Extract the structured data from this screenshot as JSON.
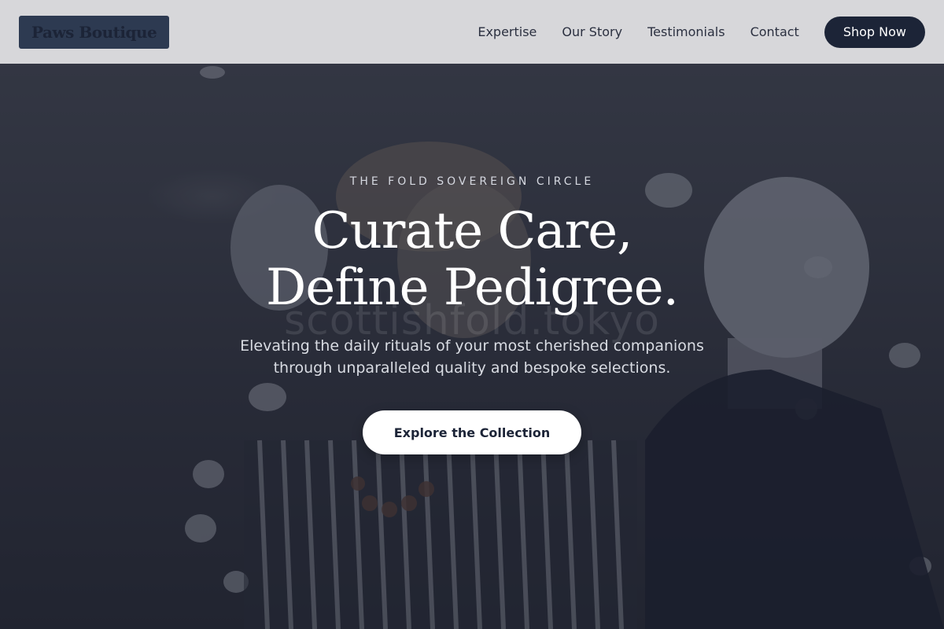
{
  "brand": {
    "name": "Paws Boutique",
    "badge_color": "#2d3a51"
  },
  "nav": {
    "links": [
      "Expertise",
      "Our Story",
      "Testimonials",
      "Contact"
    ],
    "cta_label": "Shop Now",
    "cta_color": "#1c2437"
  },
  "hero": {
    "eyebrow": "THE FOLD SOVEREIGN CIRCLE",
    "headline_line1": "Curate Care,",
    "headline_line2": "Define Pedigree.",
    "subtext_line1": "Elevating the daily rituals of your most cherished companions",
    "subtext_line2": "through unparalleled quality and bespoke selections.",
    "cta_label": "Explore the Collection",
    "watermark": "scottishfold.tokyo",
    "background_image": "boutique-mannequins-photo"
  }
}
